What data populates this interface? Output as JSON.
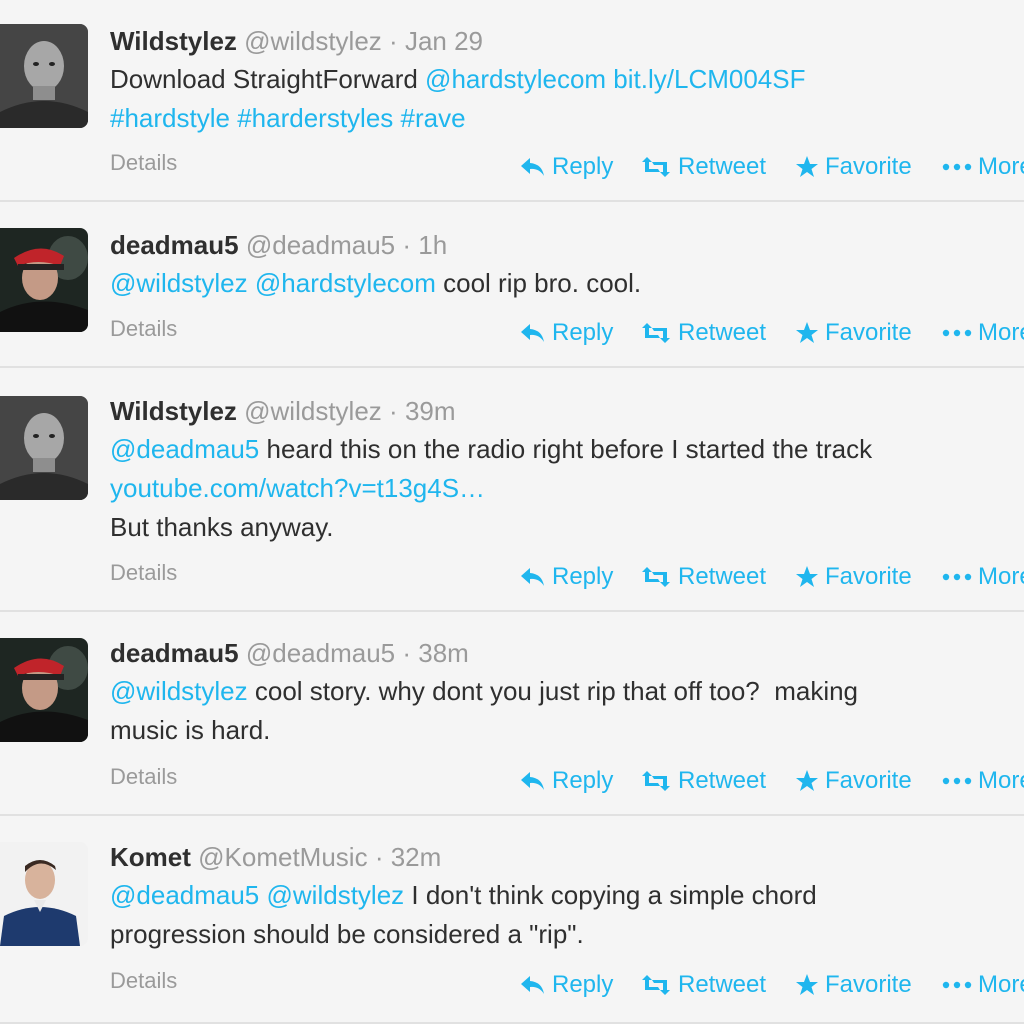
{
  "actions": {
    "reply": "Reply",
    "retweet": "Retweet",
    "favorite": "Favorite",
    "more": "More",
    "details": "Details"
  },
  "tweets": [
    {
      "name": "Wildstylez",
      "handle": "@wildstylez",
      "dot": "·",
      "time": "Jan 29",
      "lines": [
        [
          {
            "t": "Download StraightForward ",
            "l": false
          },
          {
            "t": "@hardstylecom",
            "l": true
          },
          {
            "t": " ",
            "l": false
          },
          {
            "t": "bit.ly/LCM004SF",
            "l": true
          }
        ],
        [
          {
            "t": "#hardstyle",
            "l": true
          },
          {
            "t": " ",
            "l": false
          },
          {
            "t": "#harderstyles",
            "l": true
          },
          {
            "t": " ",
            "l": false
          },
          {
            "t": "#rave",
            "l": true
          }
        ]
      ]
    },
    {
      "name": "deadmau5",
      "handle": "@deadmau5",
      "dot": "·",
      "time": "1h",
      "lines": [
        [
          {
            "t": "@wildstylez",
            "l": true
          },
          {
            "t": " ",
            "l": false
          },
          {
            "t": "@hardstylecom",
            "l": true
          },
          {
            "t": " cool rip bro. cool.",
            "l": false
          }
        ]
      ]
    },
    {
      "name": "Wildstylez",
      "handle": "@wildstylez",
      "dot": "·",
      "time": "39m",
      "lines": [
        [
          {
            "t": "@deadmau5",
            "l": true
          },
          {
            "t": " heard this on the radio right before I started the track",
            "l": false
          }
        ],
        [
          {
            "t": "youtube.com/watch?v=t13g4S…",
            "l": true
          }
        ],
        [
          {
            "t": "But thanks anyway.",
            "l": false
          }
        ]
      ]
    },
    {
      "name": "deadmau5",
      "handle": "@deadmau5",
      "dot": "·",
      "time": "38m",
      "lines": [
        [
          {
            "t": "@wildstylez",
            "l": true
          },
          {
            "t": " cool story. why dont you just rip that off too?  making",
            "l": false
          }
        ],
        [
          {
            "t": "music is hard.",
            "l": false
          }
        ]
      ]
    },
    {
      "name": "Komet",
      "handle": "@KometMusic",
      "dot": "·",
      "time": "32m",
      "lines": [
        [
          {
            "t": "@deadmau5",
            "l": true
          },
          {
            "t": " ",
            "l": false
          },
          {
            "t": "@wildstylez",
            "l": true
          },
          {
            "t": " I don't think copying a simple chord",
            "l": false
          }
        ],
        [
          {
            "t": "progression should be considered a \"rip\".",
            "l": false
          }
        ]
      ]
    }
  ],
  "colors": {
    "link": "#1fb6ee",
    "background": "#f5f5f5",
    "divider": "#e1e1e1",
    "muted": "#9a9a9a"
  },
  "icons": {
    "reply": "reply-arrow-icon",
    "retweet": "retweet-icon",
    "favorite": "star-icon",
    "more": "ellipsis-icon"
  }
}
